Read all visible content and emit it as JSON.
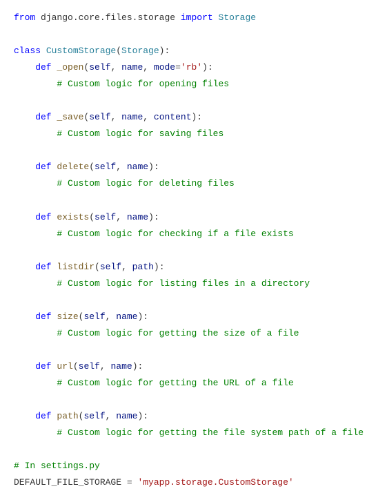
{
  "code": {
    "l1_kw_from": "from",
    "l1_mod": " django.core.files.storage ",
    "l1_kw_import": "import",
    "l1_cls": " Storage",
    "l3_kw_class": "class",
    "l3_cls_name": " CustomStorage",
    "l3_paren_open": "(",
    "l3_base": "Storage",
    "l3_paren_close": "):",
    "l4_kw_def": "    def",
    "l4_fn": " _open",
    "l4_sig_open": "(",
    "l4_self": "self",
    "l4_c1": ", ",
    "l4_name": "name",
    "l4_c2": ", ",
    "l4_mode": "mode",
    "l4_eq": "=",
    "l4_str": "'rb'",
    "l4_sig_close": "):",
    "l5_cmt": "        # Custom logic for opening files",
    "l7_kw_def": "    def",
    "l7_fn": " _save",
    "l7_sig_open": "(",
    "l7_self": "self",
    "l7_c1": ", ",
    "l7_name": "name",
    "l7_c2": ", ",
    "l7_content": "content",
    "l7_sig_close": "):",
    "l8_cmt": "        # Custom logic for saving files",
    "l10_kw_def": "    def",
    "l10_fn": " delete",
    "l10_sig_open": "(",
    "l10_self": "self",
    "l10_c1": ", ",
    "l10_name": "name",
    "l10_sig_close": "):",
    "l11_cmt": "        # Custom logic for deleting files",
    "l13_kw_def": "    def",
    "l13_fn": " exists",
    "l13_sig_open": "(",
    "l13_self": "self",
    "l13_c1": ", ",
    "l13_name": "name",
    "l13_sig_close": "):",
    "l14_cmt": "        # Custom logic for checking if a file exists",
    "l16_kw_def": "    def",
    "l16_fn": " listdir",
    "l16_sig_open": "(",
    "l16_self": "self",
    "l16_c1": ", ",
    "l16_path": "path",
    "l16_sig_close": "):",
    "l17_cmt": "        # Custom logic for listing files in a directory",
    "l19_kw_def": "    def",
    "l19_fn": " size",
    "l19_sig_open": "(",
    "l19_self": "self",
    "l19_c1": ", ",
    "l19_name": "name",
    "l19_sig_close": "):",
    "l20_cmt": "        # Custom logic for getting the size of a file",
    "l22_kw_def": "    def",
    "l22_fn": " url",
    "l22_sig_open": "(",
    "l22_self": "self",
    "l22_c1": ", ",
    "l22_name": "name",
    "l22_sig_close": "):",
    "l23_cmt": "        # Custom logic for getting the URL of a file",
    "l25_kw_def": "    def",
    "l25_fn": " path",
    "l25_sig_open": "(",
    "l25_self": "self",
    "l25_c1": ", ",
    "l25_name": "name",
    "l25_sig_close": "):",
    "l26_cmt": "        # Custom logic for getting the file system path of a file",
    "l28_cmt": "# In settings.py",
    "l29_var": "DEFAULT_FILE_STORAGE ",
    "l29_eq": "=",
    "l29_str": " 'myapp.storage.CustomStorage'"
  }
}
